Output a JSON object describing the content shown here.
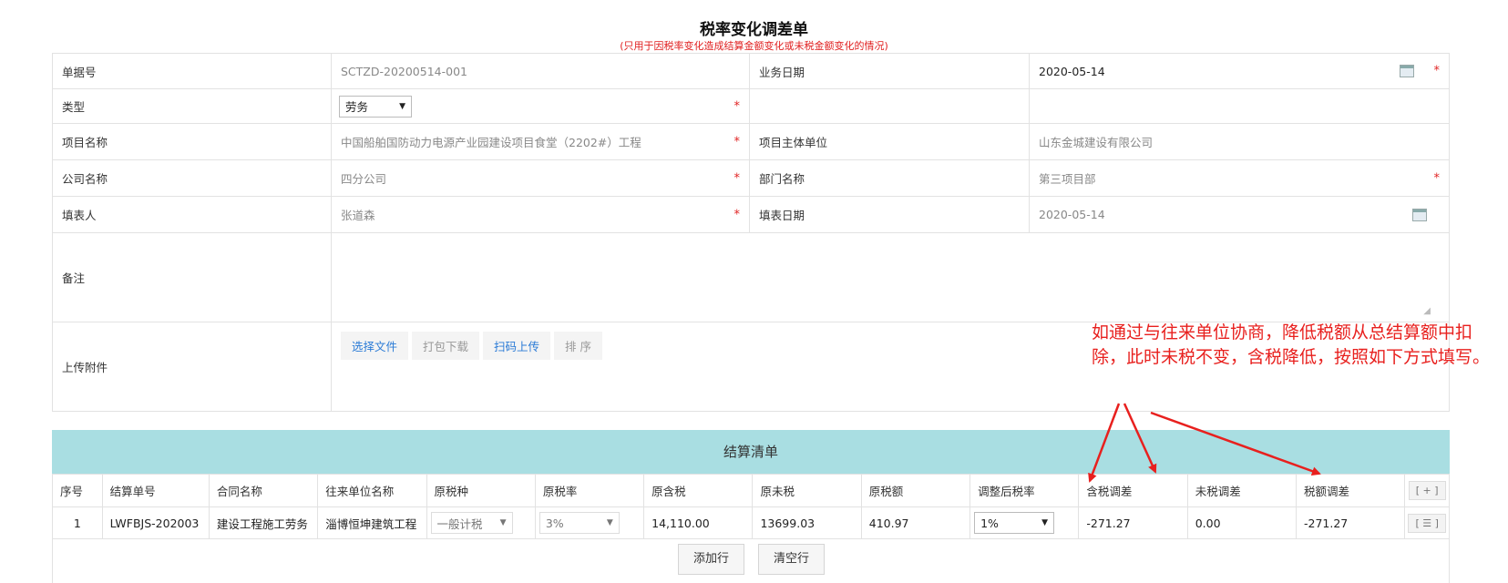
{
  "header": {
    "title": "税率变化调差单",
    "subtitle": "(只用于因税率变化造成结算金额变化或未税金额变化的情况)"
  },
  "form": {
    "doc_no_label": "单据号",
    "doc_no_value": "SCTZD-20200514-001",
    "biz_date_label": "业务日期",
    "biz_date_value": "2020-05-14",
    "type_label": "类型",
    "type_value": "劳务",
    "project_name_label": "项目名称",
    "project_name_value": "中国船舶国防动力电源产业园建设项目食堂（2202#）工程",
    "project_owner_label": "项目主体单位",
    "project_owner_value": "山东金城建设有限公司",
    "company_label": "公司名称",
    "company_value": "四分公司",
    "dept_label": "部门名称",
    "dept_value": "第三项目部",
    "filler_label": "填表人",
    "filler_value": "张道森",
    "fill_date_label": "填表日期",
    "fill_date_value": "2020-05-14",
    "remark_label": "备注",
    "attach_label": "上传附件",
    "required_mark": "*"
  },
  "attach_buttons": {
    "select_file": "选择文件",
    "pack_download": "打包下载",
    "scan_upload": "扫码上传",
    "sort": "排 序"
  },
  "settlement": {
    "title": "结算清单",
    "columns": [
      "序号",
      "结算单号",
      "合同名称",
      "往来单位名称",
      "原税种",
      "原税率",
      "原含税",
      "原未税",
      "原税额",
      "调整后税率",
      "含税调差",
      "未税调差",
      "税额调差"
    ],
    "add_col_btn": "[ + ]",
    "row": {
      "no": "1",
      "settle_no": "LWFBJS-202003",
      "contract": "建设工程施工劳务",
      "partner": "淄博恒坤建筑工程",
      "tax_type": "一般计税",
      "orig_rate": "3%",
      "orig_incl": "14,110.00",
      "orig_excl": "13699.03",
      "orig_tax": "410.97",
      "new_rate": "1%",
      "diff_incl": "-271.27",
      "diff_excl": "0.00",
      "diff_tax": "-271.27",
      "row_menu_btn": "[ ☰ ]"
    },
    "add_row": "添加行",
    "clear_rows": "清空行"
  },
  "annotation": {
    "text": "如通过与往来单位协商，降低税额从总结算额中扣除，此时未税不变，含税降低，按照如下方式填写。"
  },
  "colors": {
    "required": "#e02020",
    "section_head": "#a9dee2",
    "annotation": "#e8201e",
    "link_blue": "#2b7bd6"
  }
}
